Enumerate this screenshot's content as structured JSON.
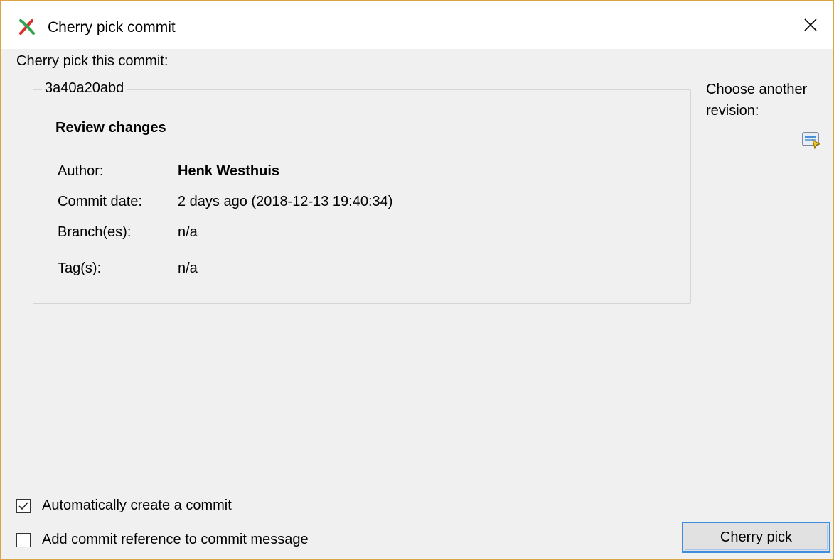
{
  "window": {
    "title": "Cherry pick commit"
  },
  "heading": "Cherry pick this commit:",
  "commit": {
    "hash": "3a40a20abd",
    "review_title": "Review changes",
    "author_label": "Author:",
    "author_value": "Henk Westhuis",
    "date_label": "Commit date:",
    "date_value": "2 days ago (2018-12-13 19:40:34)",
    "branch_label": "Branch(es):",
    "branch_value": "n/a",
    "tag_label": "Tag(s):",
    "tag_value": "n/a"
  },
  "side": {
    "choose_label": "Choose another revision:"
  },
  "options": {
    "auto_commit": {
      "label": "Automatically create a commit",
      "checked": true
    },
    "add_reference": {
      "label": "Add commit reference to commit message",
      "checked": false
    }
  },
  "actions": {
    "cherry_pick_label": "Cherry pick"
  },
  "colors": {
    "accent": "#3c8dde",
    "window_border": "#d9a441",
    "icon_green": "#2ea44f",
    "icon_red": "#d9302c"
  },
  "icons": {
    "app": "cherry-pick-icon",
    "close": "close-icon",
    "revision": "revision-picker-icon"
  }
}
